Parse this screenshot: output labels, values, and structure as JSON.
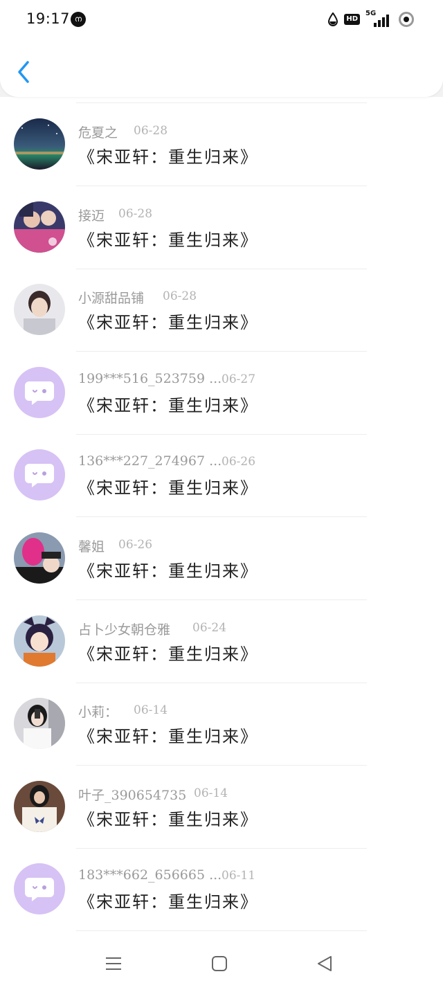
{
  "status_bar": {
    "time": "19:17",
    "notification_badge": "ന",
    "hd": "HD",
    "network": "5G"
  },
  "header": {
    "back_icon": "chevron-left-icon",
    "accent": "#2196f3"
  },
  "rows": [
    {
      "name": "危夏之",
      "date": "06-28",
      "comment": "《宋亚轩：重生归来》",
      "avatar": "photo-night-sky"
    },
    {
      "name": "接迈",
      "date": "06-28",
      "comment": "《宋亚轩：重生归来》",
      "avatar": "photo-pink-couple"
    },
    {
      "name": "小源甜品铺",
      "date": "06-28",
      "comment": "《宋亚轩：重生归来》",
      "avatar": "photo-boy-portrait"
    },
    {
      "name": "199***516_523759 ...",
      "date": "06-27",
      "comment": "《宋亚轩：重生归来》",
      "avatar": "default-chat-bubble"
    },
    {
      "name": "136***227_274967 ...",
      "date": "06-26",
      "comment": "《宋亚轩：重生归来》",
      "avatar": "default-chat-bubble"
    },
    {
      "name": "馨姐",
      "date": "06-26",
      "comment": "《宋亚轩：重生归来》",
      "avatar": "photo-pink-mask"
    },
    {
      "name": "占卜少女朝仓雅",
      "date": "06-24",
      "comment": "《宋亚轩：重生归来》",
      "avatar": "photo-anime-boy"
    },
    {
      "name": "小莉：",
      "date": "06-14",
      "comment": "《宋亚轩：重生归来》",
      "avatar": "photo-girl-selfie"
    },
    {
      "name": "叶子_390654735",
      "date": "06-14",
      "comment": "《宋亚轩：重生归来》",
      "avatar": "photo-butterfly-shirt"
    },
    {
      "name": "183***662_656665 ...",
      "date": "06-11",
      "comment": "《宋亚轩：重生归来》",
      "avatar": "default-chat-bubble"
    }
  ],
  "nav": {
    "menu_icon": "menu-icon",
    "home_icon": "home-square-icon",
    "back_icon": "back-triangle-icon"
  }
}
